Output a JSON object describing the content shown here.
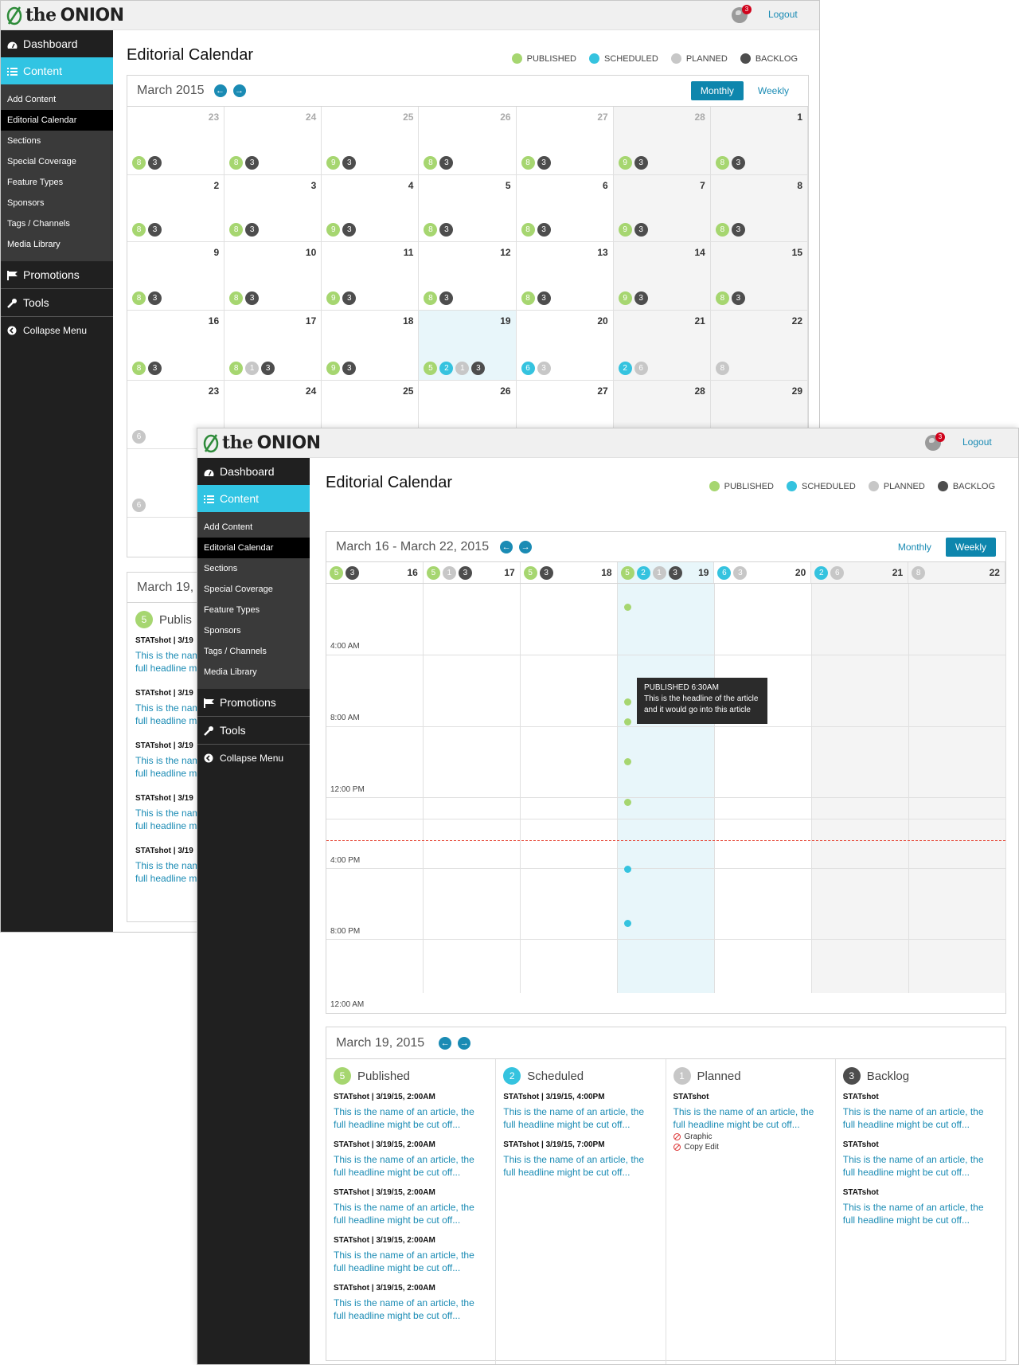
{
  "brand": {
    "logo_text_1": "the",
    "logo_text_2": "ONION",
    "notification_count": "3",
    "logout": "Logout"
  },
  "colors": {
    "published": "#a6d670",
    "scheduled": "#35c3df",
    "planned": "#c7c7c7",
    "backlog": "#4d4d4d",
    "accent": "#1a8bb4",
    "nav_active": "#31c4e3"
  },
  "sidebar": {
    "dashboard": "Dashboard",
    "content": "Content",
    "items": [
      {
        "label": "Add Content"
      },
      {
        "label": "Editorial Calendar"
      },
      {
        "label": "Sections"
      },
      {
        "label": "Special Coverage"
      },
      {
        "label": "Feature Types"
      },
      {
        "label": "Sponsors"
      },
      {
        "label": "Tags / Channels"
      },
      {
        "label": "Media Library"
      }
    ],
    "promotions": "Promotions",
    "tools": "Tools",
    "collapse": "Collapse Menu"
  },
  "page": {
    "title": "Editorial Calendar"
  },
  "legend": {
    "published": "PUBLISHED",
    "scheduled": "SCHEDULED",
    "planned": "PLANNED",
    "backlog": "BACKLOG"
  },
  "view_toggle": {
    "monthly": "Monthly",
    "weekly": "Weekly"
  },
  "monthly": {
    "heading": "March 2015",
    "weeks": [
      [
        {
          "d": "23",
          "o": true,
          "c": [
            [
              "p",
              "8"
            ],
            [
              "b",
              "3"
            ]
          ]
        },
        {
          "d": "24",
          "o": true,
          "c": [
            [
              "p",
              "8"
            ],
            [
              "b",
              "3"
            ]
          ]
        },
        {
          "d": "25",
          "o": true,
          "c": [
            [
              "p",
              "9"
            ],
            [
              "b",
              "3"
            ]
          ]
        },
        {
          "d": "26",
          "o": true,
          "c": [
            [
              "p",
              "8"
            ],
            [
              "b",
              "3"
            ]
          ]
        },
        {
          "d": "27",
          "o": true,
          "c": [
            [
              "p",
              "8"
            ],
            [
              "b",
              "3"
            ]
          ]
        },
        {
          "d": "28",
          "o": true,
          "c": [
            [
              "p",
              "9"
            ],
            [
              "b",
              "3"
            ]
          ]
        },
        {
          "d": "1",
          "c": [
            [
              "p",
              "8"
            ],
            [
              "b",
              "3"
            ]
          ]
        }
      ],
      [
        {
          "d": "2",
          "c": [
            [
              "p",
              "8"
            ],
            [
              "b",
              "3"
            ]
          ]
        },
        {
          "d": "3",
          "c": [
            [
              "p",
              "8"
            ],
            [
              "b",
              "3"
            ]
          ]
        },
        {
          "d": "4",
          "c": [
            [
              "p",
              "9"
            ],
            [
              "b",
              "3"
            ]
          ]
        },
        {
          "d": "5",
          "c": [
            [
              "p",
              "8"
            ],
            [
              "b",
              "3"
            ]
          ]
        },
        {
          "d": "6",
          "c": [
            [
              "p",
              "8"
            ],
            [
              "b",
              "3"
            ]
          ]
        },
        {
          "d": "7",
          "c": [
            [
              "p",
              "9"
            ],
            [
              "b",
              "3"
            ]
          ]
        },
        {
          "d": "8",
          "c": [
            [
              "p",
              "8"
            ],
            [
              "b",
              "3"
            ]
          ]
        }
      ],
      [
        {
          "d": "9",
          "c": [
            [
              "p",
              "8"
            ],
            [
              "b",
              "3"
            ]
          ]
        },
        {
          "d": "10",
          "c": [
            [
              "p",
              "8"
            ],
            [
              "b",
              "3"
            ]
          ]
        },
        {
          "d": "11",
          "c": [
            [
              "p",
              "9"
            ],
            [
              "b",
              "3"
            ]
          ]
        },
        {
          "d": "12",
          "c": [
            [
              "p",
              "8"
            ],
            [
              "b",
              "3"
            ]
          ]
        },
        {
          "d": "13",
          "c": [
            [
              "p",
              "8"
            ],
            [
              "b",
              "3"
            ]
          ]
        },
        {
          "d": "14",
          "c": [
            [
              "p",
              "9"
            ],
            [
              "b",
              "3"
            ]
          ]
        },
        {
          "d": "15",
          "c": [
            [
              "p",
              "8"
            ],
            [
              "b",
              "3"
            ]
          ]
        }
      ],
      [
        {
          "d": "16",
          "c": [
            [
              "p",
              "8"
            ],
            [
              "b",
              "3"
            ]
          ]
        },
        {
          "d": "17",
          "c": [
            [
              "p",
              "8"
            ],
            [
              "l",
              "1"
            ],
            [
              "b",
              "3"
            ]
          ]
        },
        {
          "d": "18",
          "c": [
            [
              "p",
              "9"
            ],
            [
              "b",
              "3"
            ]
          ]
        },
        {
          "d": "19",
          "t": true,
          "c": [
            [
              "p",
              "5"
            ],
            [
              "s",
              "2"
            ],
            [
              "l",
              "1"
            ],
            [
              "b",
              "3"
            ]
          ]
        },
        {
          "d": "20",
          "c": [
            [
              "s",
              "6"
            ],
            [
              "l",
              "3"
            ]
          ]
        },
        {
          "d": "21",
          "c": [
            [
              "s",
              "2"
            ],
            [
              "l",
              "6"
            ]
          ]
        },
        {
          "d": "22",
          "c": [
            [
              "l",
              "8"
            ]
          ]
        }
      ],
      [
        {
          "d": "23",
          "c": [
            [
              "l",
              "6"
            ]
          ]
        },
        {
          "d": "24",
          "c": []
        },
        {
          "d": "25",
          "c": []
        },
        {
          "d": "26",
          "c": []
        },
        {
          "d": "27",
          "c": []
        },
        {
          "d": "28",
          "c": []
        },
        {
          "d": "29",
          "c": []
        }
      ],
      [
        {
          "d": "",
          "c": [
            [
              "l",
              "6"
            ]
          ]
        },
        {
          "d": "",
          "c": []
        },
        {
          "d": "",
          "c": []
        },
        {
          "d": "",
          "c": []
        },
        {
          "d": "",
          "c": []
        },
        {
          "d": "",
          "c": []
        },
        {
          "d": "",
          "c": []
        }
      ]
    ],
    "detail_heading": "March 19,",
    "detail_published_label": "Publis",
    "detail_items": [
      {
        "meta": "STATshot  |  3/19",
        "hl1": "This is the nam",
        "hl2": "full headline m"
      },
      {
        "meta": "STATshot  |  3/19",
        "hl1": "This is the nam",
        "hl2": "full headline m"
      },
      {
        "meta": "STATshot  |  3/19",
        "hl1": "This is the nam",
        "hl2": "full headline m"
      },
      {
        "meta": "STATshot  |  3/19",
        "hl1": "This is the nam",
        "hl2": "full headline m"
      },
      {
        "meta": "STATshot  |  3/19",
        "hl1": "This is the nam",
        "hl2": "full headline m"
      }
    ]
  },
  "weekly": {
    "heading": "March 16 - March 22, 2015",
    "days": [
      {
        "d": "16",
        "c": [
          [
            "p",
            "5"
          ],
          [
            "b",
            "3"
          ]
        ]
      },
      {
        "d": "17",
        "c": [
          [
            "p",
            "5"
          ],
          [
            "l",
            "1"
          ],
          [
            "b",
            "3"
          ]
        ]
      },
      {
        "d": "18",
        "c": [
          [
            "p",
            "5"
          ],
          [
            "b",
            "3"
          ]
        ]
      },
      {
        "d": "19",
        "t": true,
        "c": [
          [
            "p",
            "5"
          ],
          [
            "s",
            "2"
          ],
          [
            "l",
            "1"
          ],
          [
            "b",
            "3"
          ]
        ]
      },
      {
        "d": "20",
        "c": [
          [
            "s",
            "6"
          ],
          [
            "l",
            "3"
          ]
        ]
      },
      {
        "d": "21",
        "c": [
          [
            "s",
            "2"
          ],
          [
            "l",
            "6"
          ]
        ]
      },
      {
        "d": "22",
        "c": [
          [
            "l",
            "8"
          ]
        ]
      }
    ],
    "time_labels": [
      "4:00 AM",
      "8:00 AM",
      "12:00 PM",
      "4:00 PM",
      "8:00 PM",
      "12:00 AM"
    ],
    "tooltip": {
      "title": "PUBLISHED  6:30AM",
      "body": "This is the headline of the article and it would go into this article"
    }
  },
  "detail": {
    "heading": "March 19, 2015",
    "columns": [
      {
        "title": "Published",
        "count": "5",
        "kind": "p",
        "items": [
          {
            "meta": "STATshot  |  3/19/15, 2:00AM",
            "hl": "This is the name of an article, the full headline might be cut off..."
          },
          {
            "meta": "STATshot  |  3/19/15, 2:00AM",
            "hl": "This is the name of an article, the full headline might be cut off..."
          },
          {
            "meta": "STATshot  |  3/19/15, 2:00AM",
            "hl": "This is the name of an article, the full headline might be cut off..."
          },
          {
            "meta": "STATshot  |  3/19/15, 2:00AM",
            "hl": "This is the name of an article, the full headline might be cut off..."
          },
          {
            "meta": "STATshot  |  3/19/15, 2:00AM",
            "hl": "This is the name of an article, the full headline might be cut off..."
          }
        ]
      },
      {
        "title": "Scheduled",
        "count": "2",
        "kind": "s",
        "items": [
          {
            "meta": "STATshot  |  3/19/15, 4:00PM",
            "hl": "This is the name of an article, the full headline might be cut off..."
          },
          {
            "meta": "STATshot  |  3/19/15, 7:00PM",
            "hl": "This is the name of an article, the full headline might be cut off..."
          }
        ]
      },
      {
        "title": "Planned",
        "count": "1",
        "kind": "l",
        "items": [
          {
            "meta": "STATshot",
            "hl": "This is the name of an article, the full headline might be cut off...",
            "tasks": [
              "Graphic",
              "Copy Edit"
            ]
          }
        ]
      },
      {
        "title": "Backlog",
        "count": "3",
        "kind": "b",
        "items": [
          {
            "meta": "STATshot",
            "hl": "This is the name of an article, the full headline might be cut off..."
          },
          {
            "meta": "STATshot",
            "hl": "This is the name of an article, the full headline might be cut off..."
          },
          {
            "meta": "STATshot",
            "hl": "This is the name of an article, the full headline might be cut off..."
          }
        ]
      }
    ]
  }
}
